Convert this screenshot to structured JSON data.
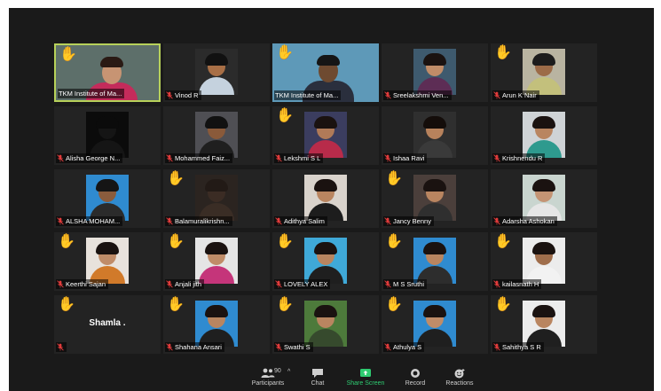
{
  "participants": [
    {
      "name": "TKM Institute of Ma...",
      "muted": false,
      "raised": true,
      "active": true,
      "wide": true,
      "bg": "#5d6f6a",
      "skin": "#c79473",
      "hair": "#2a1a14",
      "shirt": "#c42b5b"
    },
    {
      "name": "Vinod R",
      "muted": true,
      "raised": false,
      "bg": "#2b2b2b",
      "skin": "#a86f46",
      "hair": "#111111",
      "shirt": "#c5d2de"
    },
    {
      "name": "TKM Institute of Ma...",
      "muted": false,
      "raised": true,
      "wide": true,
      "bg": "#5e99b8",
      "skin": "#6e4a30",
      "hair": "#151515",
      "shirt": "#2a2f3d"
    },
    {
      "name": "Sreelakshmi Ven...",
      "muted": true,
      "raised": false,
      "bg": "#3e5a6e",
      "skin": "#c08c68",
      "hair": "#1a1210",
      "shirt": "#5d2d55"
    },
    {
      "name": "Arun K Nair",
      "muted": true,
      "raised": true,
      "bg": "#b9b4a1",
      "skin": "#9c6b48",
      "hair": "#1c1c1c",
      "shirt": "#c3c07c"
    },
    {
      "name": "Alisha George N...",
      "muted": true,
      "raised": false,
      "bg": "#0b0b0b",
      "skin": "#151515",
      "hair": "#0b0b0b",
      "shirt": "#151515"
    },
    {
      "name": "Mohammed Faiz...",
      "muted": true,
      "raised": false,
      "bg": "#4f4f54",
      "skin": "#8a5a3a",
      "hair": "#111111",
      "shirt": "#1f1f1f"
    },
    {
      "name": "Lekshmi S L",
      "muted": true,
      "raised": true,
      "bg": "#3b3d5f",
      "skin": "#b07a58",
      "hair": "#1a1210",
      "shirt": "#b82b4a"
    },
    {
      "name": "Ishaa Ravi",
      "muted": true,
      "raised": false,
      "bg": "#2f2f2f",
      "skin": "#b7825c",
      "hair": "#140d0a",
      "shirt": "#3a3a3a"
    },
    {
      "name": "Krishnendu R",
      "muted": true,
      "raised": false,
      "bg": "#cfd3d6",
      "skin": "#b98560",
      "hair": "#1a1210",
      "shirt": "#2e9a8e"
    },
    {
      "name": "ALSHA MOHAM...",
      "muted": true,
      "raised": false,
      "bg": "#2f8bd0",
      "skin": "#8a5c3d",
      "hair": "#151515",
      "shirt": "#2b2b2b"
    },
    {
      "name": "Balamuralikrishn...",
      "muted": true,
      "raised": true,
      "bg": "#2b2420",
      "skin": "#3b2c24",
      "hair": "#221a16",
      "shirt": "#3a2d25"
    },
    {
      "name": "Adithya Salim",
      "muted": true,
      "raised": false,
      "bg": "#d9d3cc",
      "skin": "#b98560",
      "hair": "#1a1210",
      "shirt": "#1d1d1d"
    },
    {
      "name": "Jancy Benny",
      "muted": true,
      "raised": true,
      "bg": "#4b3f3b",
      "skin": "#b98560",
      "hair": "#1a1210",
      "shirt": "#2f2f2f"
    },
    {
      "name": "Adarsha Ashokan",
      "muted": true,
      "raised": false,
      "bg": "#c9d5cf",
      "skin": "#c49474",
      "hair": "#1a1210",
      "shirt": "#e6e6e6"
    },
    {
      "name": "Keerthi Sajan",
      "muted": true,
      "raised": true,
      "bg": "#e8e2dc",
      "skin": "#c08c68",
      "hair": "#1a1210",
      "shirt": "#d17a2a"
    },
    {
      "name": "Anjali jith",
      "muted": true,
      "raised": true,
      "bg": "#e5e5e5",
      "skin": "#c08c68",
      "hair": "#1a1210",
      "shirt": "#c5357a"
    },
    {
      "name": "LOVELY ALEX",
      "muted": true,
      "raised": true,
      "bg": "#3fa9d8",
      "skin": "#b98560",
      "hair": "#1a1210",
      "shirt": "#1f1f1f"
    },
    {
      "name": "M S Sruthi",
      "muted": true,
      "raised": true,
      "bg": "#2f8bd0",
      "skin": "#b98560",
      "hair": "#1a1210",
      "shirt": "#2d2d2d"
    },
    {
      "name": "kailasnath H",
      "muted": true,
      "raised": true,
      "bg": "#ececec",
      "skin": "#a06e4c",
      "hair": "#1a1210",
      "shirt": "#f2f2f2"
    },
    {
      "name": "",
      "center_label": "Shamla .",
      "muted": true,
      "raised": true,
      "noVideo": true
    },
    {
      "name": "Shahana Ansari",
      "muted": true,
      "raised": true,
      "bg": "#2f8bd0",
      "skin": "#b98560",
      "hair": "#1a1210",
      "shirt": "#1f1f1f"
    },
    {
      "name": "Swathi S",
      "muted": true,
      "raised": true,
      "bg": "#4d7a3b",
      "skin": "#b98560",
      "hair": "#1a1210",
      "shirt": "#364a2d"
    },
    {
      "name": "Athulya S",
      "muted": true,
      "raised": true,
      "bg": "#2f8bd0",
      "skin": "#c08c68",
      "hair": "#1a1210",
      "shirt": "#1f1f1f"
    },
    {
      "name": "Sahithya S R",
      "muted": true,
      "raised": true,
      "bg": "#ececec",
      "skin": "#b98560",
      "hair": "#1a1210",
      "shirt": "#1f1f1f"
    }
  ],
  "toolbar": {
    "participants_label": "Participants",
    "participants_count": "90",
    "chat_label": "Chat",
    "share_label": "Share Screen",
    "record_label": "Record",
    "reactions_label": "Reactions"
  },
  "colors": {
    "window_bg": "#1a1a1a",
    "tile_bg": "#232323",
    "active_border": "#b7d15a",
    "mute_red": "#e03b3b",
    "share_green": "#2ecc71",
    "raise_hand": "#f2c230"
  }
}
